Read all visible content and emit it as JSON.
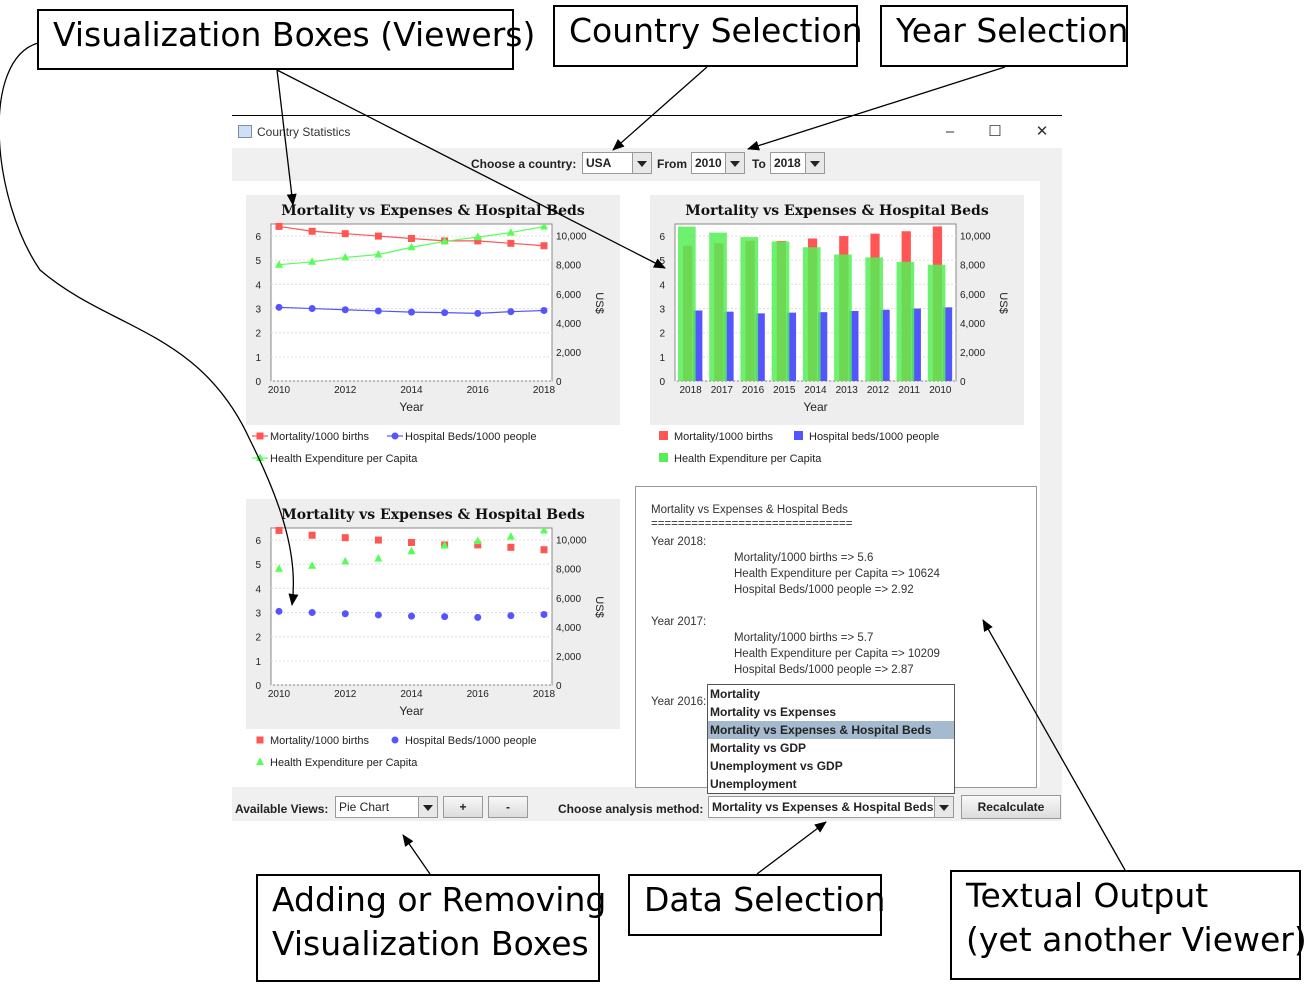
{
  "callouts": {
    "viewers": "Visualization Boxes (Viewers)",
    "country": "Country Selection",
    "year": "Year Selection",
    "add_remove_l1": "Adding or Removing",
    "add_remove_l2": "Visualization Boxes",
    "data_selection": "Data Selection",
    "textual_l1": "Textual Output",
    "textual_l2": "(yet another Viewer)"
  },
  "window": {
    "title": "Country Statistics",
    "minimize": "–",
    "maximize": "☐",
    "close": "✕"
  },
  "top": {
    "country_label": "Choose a country:",
    "country_value": "USA",
    "from_label": "From",
    "from_value": "2010",
    "to_label": "To",
    "to_value": "2018"
  },
  "bottom": {
    "views_label": "Available Views:",
    "views_value": "Pie Chart",
    "add": "+",
    "remove": "-",
    "method_label": "Choose analysis method:",
    "method_value": "Mortality vs Expenses & Hospital Beds",
    "recalc": "Recalculate"
  },
  "dropdown": {
    "options": [
      "Mortality",
      "Mortality vs Expenses",
      "Mortality vs Expenses & Hospital Beds",
      "Mortality vs GDP",
      "Unemployment vs GDP",
      "Unemployment"
    ],
    "selected": 2
  },
  "textual": {
    "title": "Mortality vs Expenses & Hospital Beds",
    "rule": "==============================",
    "years": [
      {
        "label": "Year 2018:",
        "lines": [
          "Mortality/1000 births => 5.6",
          "Health Expenditure per Capita => 10624",
          "Hospital Beds/1000 people => 2.92"
        ]
      },
      {
        "label": "Year 2017:",
        "lines": [
          "Mortality/1000 births => 5.7",
          "Health Expenditure per Capita => 10209",
          "Hospital Beds/1000 people => 2.87"
        ]
      },
      {
        "label": "Year 2016:",
        "lines": []
      }
    ]
  },
  "colors": {
    "mortality": "#f55",
    "beds": "#55f",
    "expenditure": "#5f5",
    "expenditure_bar": "#5e5",
    "plot_bg": "#fff",
    "panel_bg": "#eeeeee"
  },
  "chart_data": [
    {
      "type": "line",
      "title": "Mortality vs Expenses & Hospital Beds",
      "xlabel": "Year",
      "ylabel_right": "US$",
      "x": [
        2010,
        2011,
        2012,
        2013,
        2014,
        2015,
        2016,
        2017,
        2018
      ],
      "xticks": [
        "2010",
        "2012",
        "2014",
        "2016",
        "2018"
      ],
      "ylim_left": [
        0,
        6.5
      ],
      "yticks_left": [
        "0",
        "1",
        "2",
        "3",
        "4",
        "5",
        "6"
      ],
      "ylim_right": [
        0,
        10800
      ],
      "yticks_right": [
        "0",
        "2,000",
        "4,000",
        "6,000",
        "8,000",
        "10,000"
      ],
      "series": [
        {
          "name": "Mortality/1000 births",
          "axis": "left",
          "values": [
            6.4,
            6.2,
            6.1,
            6.0,
            5.9,
            5.8,
            5.8,
            5.7,
            5.6
          ]
        },
        {
          "name": "Hospital Beds/1000 people",
          "axis": "left",
          "values": [
            3.05,
            3.0,
            2.95,
            2.9,
            2.85,
            2.83,
            2.8,
            2.87,
            2.92
          ]
        },
        {
          "name": "Health Expenditure per Capita",
          "axis": "right",
          "values": [
            8000,
            8200,
            8500,
            8700,
            9200,
            9600,
            9900,
            10209,
            10624
          ]
        }
      ]
    },
    {
      "type": "bar",
      "title": "Mortality vs Expenses & Hospital Beds",
      "xlabel": "Year",
      "ylabel_right": "US$",
      "categories": [
        "2018",
        "2017",
        "2016",
        "2015",
        "2014",
        "2013",
        "2012",
        "2011",
        "2010"
      ],
      "ylim_left": [
        0,
        6.5
      ],
      "yticks_left": [
        "0",
        "1",
        "2",
        "3",
        "4",
        "5",
        "6"
      ],
      "ylim_right": [
        0,
        10800
      ],
      "yticks_right": [
        "0",
        "2,000",
        "4,000",
        "6,000",
        "8,000",
        "10,000"
      ],
      "series": [
        {
          "name": "Mortality/1000 births",
          "axis": "left",
          "values": [
            5.6,
            5.7,
            5.8,
            5.8,
            5.9,
            6.0,
            6.1,
            6.2,
            6.4
          ]
        },
        {
          "name": "Hospital beds/1000 people",
          "axis": "left",
          "values": [
            2.92,
            2.87,
            2.8,
            2.83,
            2.85,
            2.9,
            2.95,
            3.0,
            3.05
          ]
        },
        {
          "name": "Health Expenditure per Capita",
          "axis": "right",
          "values": [
            10624,
            10209,
            9900,
            9600,
            9200,
            8700,
            8500,
            8200,
            8000
          ]
        }
      ]
    },
    {
      "type": "scatter",
      "title": "Mortality vs Expenses & Hospital Beds",
      "xlabel": "Year",
      "ylabel_right": "US$",
      "x": [
        2010,
        2011,
        2012,
        2013,
        2014,
        2015,
        2016,
        2017,
        2018
      ],
      "xticks": [
        "2010",
        "2012",
        "2014",
        "2016",
        "2018"
      ],
      "ylim_left": [
        0,
        6.5
      ],
      "yticks_left": [
        "0",
        "1",
        "2",
        "3",
        "4",
        "5",
        "6"
      ],
      "ylim_right": [
        0,
        10800
      ],
      "yticks_right": [
        "0",
        "2,000",
        "4,000",
        "6,000",
        "8,000",
        "10,000"
      ],
      "series": [
        {
          "name": "Mortality/1000 births",
          "axis": "left",
          "values": [
            6.4,
            6.2,
            6.1,
            6.0,
            5.9,
            5.8,
            5.8,
            5.7,
            5.6
          ]
        },
        {
          "name": "Hospital Beds/1000 people",
          "axis": "left",
          "values": [
            3.05,
            3.0,
            2.95,
            2.9,
            2.85,
            2.83,
            2.8,
            2.87,
            2.92
          ]
        },
        {
          "name": "Health Expenditure per Capita",
          "axis": "right",
          "values": [
            8000,
            8200,
            8500,
            8700,
            9200,
            9600,
            9900,
            10209,
            10624
          ]
        }
      ]
    }
  ]
}
